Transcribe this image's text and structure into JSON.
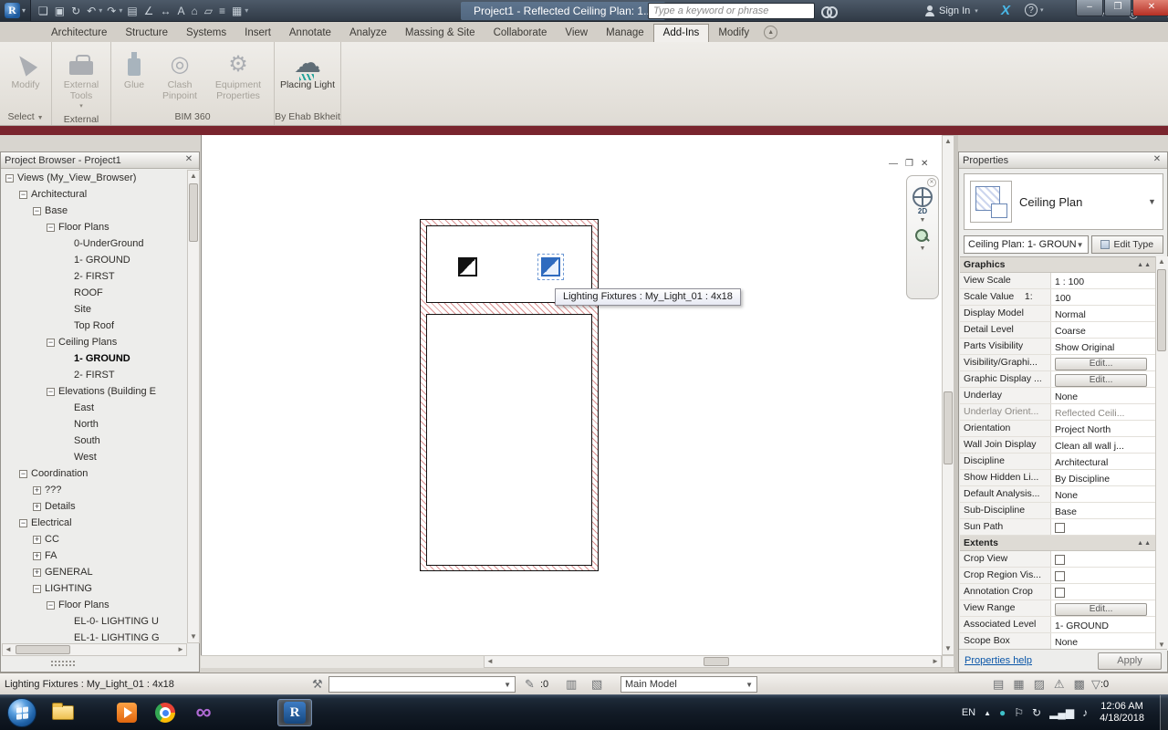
{
  "accents": {
    "selection_blue": "#2f6bbf",
    "red_strip": "#7a252e",
    "hatch_red": "#c85858",
    "link_blue": "#0a56a8"
  },
  "titlebar": {
    "title": "Project1 - Reflected Ceiling Plan: 1...",
    "search_placeholder": "Type a keyword or phrase",
    "sign_in": "Sign In",
    "exchange": "X",
    "help": "?",
    "qat": [
      {
        "name": "open-icon",
        "glyph": "❏"
      },
      {
        "name": "save-icon",
        "glyph": "▣"
      },
      {
        "name": "sync-icon",
        "glyph": "↻"
      },
      {
        "name": "undo-icon",
        "glyph": "↶",
        "caret": true
      },
      {
        "name": "redo-icon",
        "glyph": "↷",
        "caret": true
      },
      {
        "name": "print-icon",
        "glyph": "▤"
      },
      {
        "name": "measure-icon",
        "glyph": "∠"
      },
      {
        "name": "aligned-dimension-icon",
        "glyph": "↔"
      },
      {
        "name": "text-icon",
        "glyph": "A"
      },
      {
        "name": "default-3d-view-icon",
        "glyph": "⌂"
      },
      {
        "name": "section-icon",
        "glyph": "▱"
      },
      {
        "name": "thin-lines-icon",
        "glyph": "≡"
      },
      {
        "name": "switch-windows-icon",
        "glyph": "▦",
        "caret": true
      }
    ]
  },
  "ribbon": {
    "tabs": [
      {
        "label": "Architecture"
      },
      {
        "label": "Structure"
      },
      {
        "label": "Systems"
      },
      {
        "label": "Insert"
      },
      {
        "label": "Annotate"
      },
      {
        "label": "Analyze"
      },
      {
        "label": "Massing & Site"
      },
      {
        "label": "Collaborate"
      },
      {
        "label": "View"
      },
      {
        "label": "Manage"
      },
      {
        "label": "Add-Ins",
        "active": true
      },
      {
        "label": "Modify"
      }
    ],
    "panels": [
      {
        "label": "Select",
        "caret": true,
        "buttons": [
          {
            "label": "Modify",
            "icon": "cursor",
            "enabled": false
          }
        ]
      },
      {
        "label": "External",
        "buttons": [
          {
            "label": "External Tools",
            "icon": "toolbox",
            "enabled": false,
            "caret": true
          }
        ]
      },
      {
        "label": "BIM 360",
        "buttons": [
          {
            "label": "Glue",
            "icon": "glue",
            "enabled": false
          },
          {
            "label": "Clash Pinpoint",
            "icon": "clash",
            "enabled": false
          },
          {
            "label": "Equipment Properties",
            "icon": "equipment",
            "enabled": false
          }
        ]
      },
      {
        "label": "By Ehab Bkheit",
        "buttons": [
          {
            "label": "Placing Light",
            "icon": "cloud",
            "enabled": true
          }
        ]
      }
    ]
  },
  "project_browser": {
    "title": "Project Browser - Project1",
    "items": [
      {
        "label": "Views (My_View_Browser)",
        "level": 0,
        "toggle": "minus"
      },
      {
        "label": "Architectural",
        "level": 1,
        "toggle": "minus"
      },
      {
        "label": "Base",
        "level": 2,
        "toggle": "minus"
      },
      {
        "label": "Floor Plans",
        "level": 3,
        "toggle": "minus"
      },
      {
        "label": "0-UnderGround",
        "level": 4
      },
      {
        "label": "1- GROUND",
        "level": 4
      },
      {
        "label": "2- FIRST",
        "level": 4
      },
      {
        "label": "ROOF",
        "level": 4
      },
      {
        "label": "Site",
        "level": 4
      },
      {
        "label": "Top Roof",
        "level": 4
      },
      {
        "label": "Ceiling Plans",
        "level": 3,
        "toggle": "minus"
      },
      {
        "label": "1- GROUND",
        "level": 4,
        "bold": true
      },
      {
        "label": "2- FIRST",
        "level": 4
      },
      {
        "label": "Elevations (Building E",
        "level": 3,
        "toggle": "minus"
      },
      {
        "label": "East",
        "level": 4
      },
      {
        "label": "North",
        "level": 4
      },
      {
        "label": "South",
        "level": 4
      },
      {
        "label": "West",
        "level": 4
      },
      {
        "label": "Coordination",
        "level": 1,
        "toggle": "minus"
      },
      {
        "label": "???",
        "level": 2,
        "toggle": "plus"
      },
      {
        "label": "Details",
        "level": 2,
        "toggle": "plus"
      },
      {
        "label": "Electrical",
        "level": 1,
        "toggle": "minus"
      },
      {
        "label": "CC",
        "level": 2,
        "toggle": "plus"
      },
      {
        "label": "FA",
        "level": 2,
        "toggle": "plus"
      },
      {
        "label": "GENERAL",
        "level": 2,
        "toggle": "plus"
      },
      {
        "label": "LIGHTING",
        "level": 2,
        "toggle": "minus"
      },
      {
        "label": "Floor Plans",
        "level": 3,
        "toggle": "minus"
      },
      {
        "label": "EL-0- LIGHTING U",
        "level": 4
      },
      {
        "label": "EL-1- LIGHTING G",
        "level": 4
      }
    ]
  },
  "canvas": {
    "tooltip": "Lighting Fixtures : My_Light_01 : 4x18",
    "nav_2d": "2D"
  },
  "properties": {
    "title": "Properties",
    "type_label": "Ceiling Plan",
    "instance_combo": "Ceiling Plan: 1- GROUN",
    "edit_type": "Edit Type",
    "help_link": "Properties help",
    "apply": "Apply",
    "rows": [
      {
        "kind": "section",
        "label": "Graphics"
      },
      {
        "kind": "text",
        "label": "View Scale",
        "value": "1 : 100"
      },
      {
        "kind": "text",
        "label": "Scale Value    1:",
        "value": "100"
      },
      {
        "kind": "text",
        "label": "Display Model",
        "value": "Normal"
      },
      {
        "kind": "text",
        "label": "Detail Level",
        "value": "Coarse"
      },
      {
        "kind": "text",
        "label": "Parts Visibility",
        "value": "Show Original"
      },
      {
        "kind": "edit",
        "label": "Visibility/Graphi...",
        "value": "Edit..."
      },
      {
        "kind": "edit",
        "label": "Graphic Display ...",
        "value": "Edit..."
      },
      {
        "kind": "text",
        "label": "Underlay",
        "value": "None"
      },
      {
        "kind": "text",
        "label": "Underlay Orient...",
        "value": "Reflected Ceili...",
        "disabled": true
      },
      {
        "kind": "text",
        "label": "Orientation",
        "value": "Project North"
      },
      {
        "kind": "text",
        "label": "Wall Join Display",
        "value": "Clean all wall j..."
      },
      {
        "kind": "text",
        "label": "Discipline",
        "value": "Architectural"
      },
      {
        "kind": "text",
        "label": "Show Hidden Li...",
        "value": "By Discipline"
      },
      {
        "kind": "text",
        "label": "Default Analysis...",
        "value": "None"
      },
      {
        "kind": "text",
        "label": "Sub-Discipline",
        "value": "Base"
      },
      {
        "kind": "check",
        "label": "Sun Path",
        "checked": false
      },
      {
        "kind": "section",
        "label": "Extents"
      },
      {
        "kind": "check",
        "label": "Crop View",
        "checked": false
      },
      {
        "kind": "check",
        "label": "Crop Region Vis...",
        "checked": false
      },
      {
        "kind": "check",
        "label": "Annotation Crop",
        "checked": false
      },
      {
        "kind": "edit",
        "label": "View Range",
        "value": "Edit..."
      },
      {
        "kind": "text",
        "label": "Associated Level",
        "value": "1- GROUND"
      },
      {
        "kind": "text",
        "label": "Scope Box",
        "value": "None"
      }
    ]
  },
  "statusbar": {
    "left_text": "Lighting Fixtures : My_Light_01 : 4x18",
    "editable_count": ":0",
    "main_model": "Main Model",
    "filter_count": ":0"
  },
  "taskbar": {
    "language": "EN",
    "time": "12:06 AM",
    "date": "4/18/2018"
  }
}
